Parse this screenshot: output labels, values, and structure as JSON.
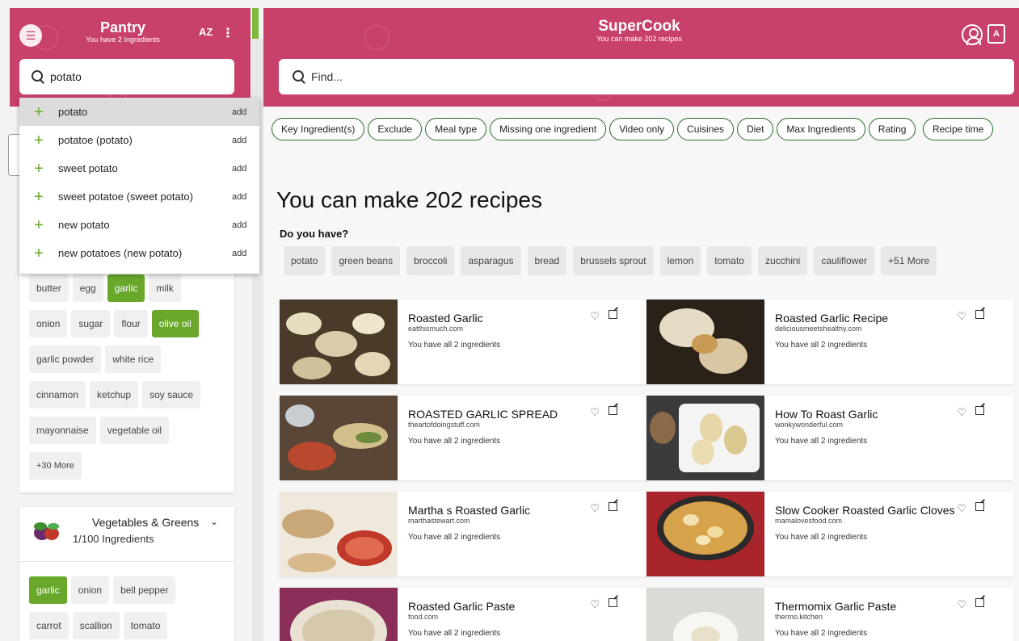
{
  "pantry": {
    "title": "Pantry",
    "subtitle": "You have 2 Ingredients",
    "sort_label": "AZ",
    "search_value": "potato",
    "suggestions": [
      {
        "label": "potato",
        "action": "add"
      },
      {
        "label": "potatoe (potato)",
        "action": "add"
      },
      {
        "label": "sweet potato",
        "action": "add"
      },
      {
        "label": "sweet potatoe (sweet potato)",
        "action": "add"
      },
      {
        "label": "new potato",
        "action": "add"
      },
      {
        "label": "new potatoes (new potato)",
        "action": "add"
      }
    ],
    "pantry_essentials": [
      {
        "label": "butter",
        "selected": false
      },
      {
        "label": "egg",
        "selected": false
      },
      {
        "label": "garlic",
        "selected": true
      },
      {
        "label": "milk",
        "selected": false
      },
      {
        "label": "onion",
        "selected": false
      },
      {
        "label": "sugar",
        "selected": false
      },
      {
        "label": "flour",
        "selected": false
      },
      {
        "label": "olive oil",
        "selected": true
      },
      {
        "label": "garlic powder",
        "selected": false
      },
      {
        "label": "white rice",
        "selected": false
      },
      {
        "label": "cinnamon",
        "selected": false
      },
      {
        "label": "ketchup",
        "selected": false
      },
      {
        "label": "soy sauce",
        "selected": false
      },
      {
        "label": "mayonnaise",
        "selected": false
      },
      {
        "label": "vegetable oil",
        "selected": false
      },
      {
        "label": "+30 More",
        "selected": false
      }
    ],
    "vegetables": {
      "title": "Vegetables & Greens",
      "count": "1/100 Ingredients",
      "chips": [
        {
          "label": "garlic",
          "selected": true
        },
        {
          "label": "onion",
          "selected": false
        },
        {
          "label": "bell pepper",
          "selected": false
        },
        {
          "label": "carrot",
          "selected": false
        },
        {
          "label": "scallion",
          "selected": false
        },
        {
          "label": "tomato",
          "selected": false
        }
      ]
    }
  },
  "main": {
    "title": "SuperCook",
    "subtitle": "You can make 202 recipes",
    "search_placeholder": "Find...",
    "filters": [
      "Key Ingredient(s)",
      "Exclude",
      "Meal type",
      "Missing one ingredient",
      "Video only",
      "Cuisines",
      "Diet",
      "Max Ingredients",
      "Rating",
      "Recipe time"
    ],
    "headline": "You can make 202 recipes",
    "do_you_have": "Do you have?",
    "have_chips": [
      "potato",
      "green beans",
      "broccoli",
      "asparagus",
      "bread",
      "brussels sprout",
      "lemon",
      "tomato",
      "zucchini",
      "cauliflower",
      "+51 More"
    ],
    "recipes": [
      {
        "name": "Roasted Garlic",
        "source": "eatthismuch.com",
        "status": "You have all 2 ingredients"
      },
      {
        "name": "Roasted Garlic Recipe",
        "source": "deliciousmeetshealthy.com",
        "status": "You have all 2 ingredients"
      },
      {
        "name": "ROASTED GARLIC SPREAD",
        "source": "theartofdoingstuff.com",
        "status": "You have all 2 ingredients"
      },
      {
        "name": "How To Roast Garlic",
        "source": "wonkywonderful.com",
        "status": "You have all 2 ingredients"
      },
      {
        "name": "Martha s Roasted Garlic",
        "source": "marthastewart.com",
        "status": "You have all 2 ingredients"
      },
      {
        "name": "Slow Cooker Roasted Garlic Cloves",
        "source": "mamalovesfood.com",
        "status": "You have all 2 ingredients"
      },
      {
        "name": "Roasted Garlic Paste",
        "source": "food.com",
        "status": "You have all 2 ingredients"
      },
      {
        "name": "Thermomix Garlic Paste",
        "source": "thermo.kitchen",
        "status": "You have all 2 ingredients"
      }
    ]
  },
  "colors": {
    "brand": "#c8416b",
    "accent_green": "#6aa82c",
    "filter_border": "#2d6a2d"
  },
  "icons": [
    "menu-icon",
    "sort-az-icon",
    "more-vert-icon",
    "search-icon",
    "plus-icon",
    "user-icon",
    "translate-icon",
    "heart-icon",
    "external-link-icon",
    "chevron-down-icon",
    "vegetables-icon"
  ]
}
